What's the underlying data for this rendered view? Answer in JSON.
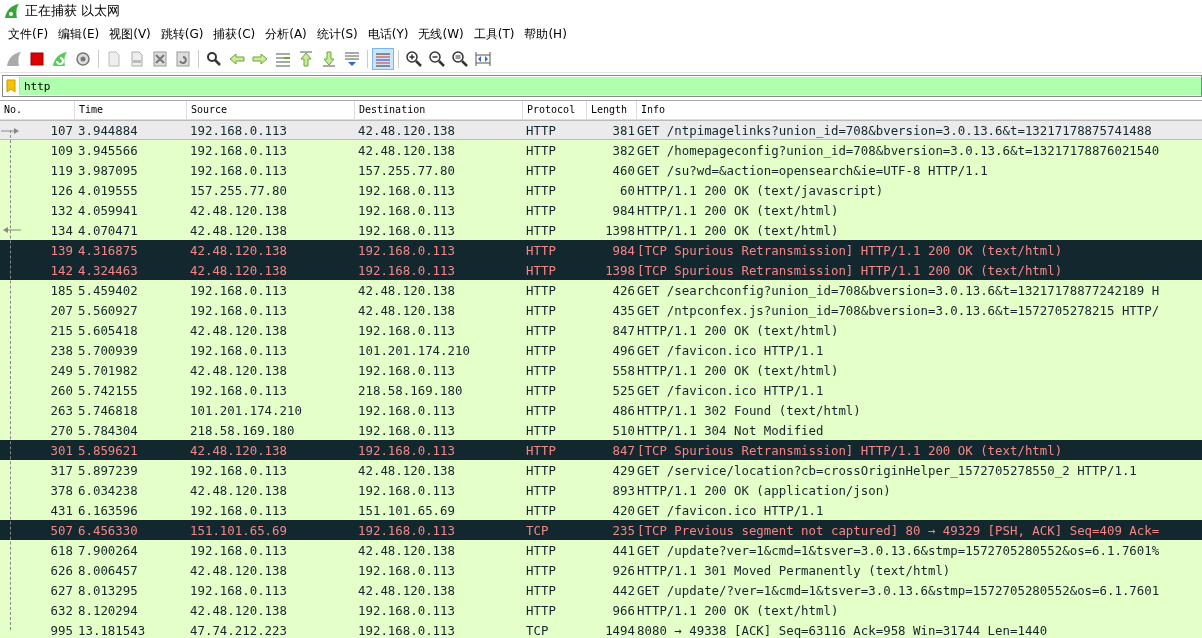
{
  "window": {
    "title": "正在捕获 以太网"
  },
  "menu": [
    "文件(F)",
    "编辑(E)",
    "视图(V)",
    "跳转(G)",
    "捕获(C)",
    "分析(A)",
    "统计(S)",
    "电话(Y)",
    "无线(W)",
    "工具(T)",
    "帮助(H)"
  ],
  "toolbar": {
    "colorize_on": true
  },
  "filter": {
    "value": "http"
  },
  "table": {
    "columns": [
      "No.",
      "Time",
      "Source",
      "Destination",
      "Protocol",
      "Length",
      "Info"
    ],
    "rows": [
      {
        "no": "107",
        "time": "3.944884",
        "source": "192.168.0.113",
        "destination": "42.48.120.138",
        "protocol": "HTTP",
        "length": "381",
        "info": "GET /ntpimagelinks?union_id=708&bversion=3.0.13.6&t=13217178875741488",
        "kind": "normal",
        "selected": true,
        "request_arrow": true
      },
      {
        "no": "109",
        "time": "3.945566",
        "source": "192.168.0.113",
        "destination": "42.48.120.138",
        "protocol": "HTTP",
        "length": "382",
        "info": "GET /homepageconfig?union_id=708&bversion=3.0.13.6&t=13217178876021540",
        "kind": "normal",
        "selected": false
      },
      {
        "no": "119",
        "time": "3.987095",
        "source": "192.168.0.113",
        "destination": "157.255.77.80",
        "protocol": "HTTP",
        "length": "460",
        "info": "GET /su?wd=&action=opensearch&ie=UTF-8 HTTP/1.1",
        "kind": "normal",
        "selected": false
      },
      {
        "no": "126",
        "time": "4.019555",
        "source": "157.255.77.80",
        "destination": "192.168.0.113",
        "protocol": "HTTP",
        "length": "60",
        "info": "HTTP/1.1 200 OK  (text/javascript)",
        "kind": "normal",
        "selected": false
      },
      {
        "no": "132",
        "time": "4.059941",
        "source": "42.48.120.138",
        "destination": "192.168.0.113",
        "protocol": "HTTP",
        "length": "984",
        "info": "HTTP/1.1 200 OK  (text/html)",
        "kind": "normal",
        "selected": false
      },
      {
        "no": "134",
        "time": "4.070471",
        "source": "42.48.120.138",
        "destination": "192.168.0.113",
        "protocol": "HTTP",
        "length": "1398",
        "info": "HTTP/1.1 200 OK  (text/html)",
        "kind": "normal",
        "selected": false,
        "response_arrow": true
      },
      {
        "no": "139",
        "time": "4.316875",
        "source": "42.48.120.138",
        "destination": "192.168.0.113",
        "protocol": "HTTP",
        "length": "984",
        "info": "[TCP Spurious Retransmission] HTTP/1.1 200 OK  (text/html)",
        "kind": "error",
        "selected": false
      },
      {
        "no": "142",
        "time": "4.324463",
        "source": "42.48.120.138",
        "destination": "192.168.0.113",
        "protocol": "HTTP",
        "length": "1398",
        "info": "[TCP Spurious Retransmission] HTTP/1.1 200 OK  (text/html)",
        "kind": "error",
        "selected": false
      },
      {
        "no": "185",
        "time": "5.459402",
        "source": "192.168.0.113",
        "destination": "42.48.120.138",
        "protocol": "HTTP",
        "length": "426",
        "info": "GET /searchconfig?union_id=708&bversion=3.0.13.6&t=13217178877242189 H",
        "kind": "normal",
        "selected": false
      },
      {
        "no": "207",
        "time": "5.560927",
        "source": "192.168.0.113",
        "destination": "42.48.120.138",
        "protocol": "HTTP",
        "length": "435",
        "info": "GET /ntpconfex.js?union_id=708&bversion=3.0.13.6&t=1572705278215 HTTP/",
        "kind": "normal",
        "selected": false
      },
      {
        "no": "215",
        "time": "5.605418",
        "source": "42.48.120.138",
        "destination": "192.168.0.113",
        "protocol": "HTTP",
        "length": "847",
        "info": "HTTP/1.1 200 OK  (text/html)",
        "kind": "normal",
        "selected": false
      },
      {
        "no": "238",
        "time": "5.700939",
        "source": "192.168.0.113",
        "destination": "101.201.174.210",
        "protocol": "HTTP",
        "length": "496",
        "info": "GET /favicon.ico HTTP/1.1",
        "kind": "normal",
        "selected": false
      },
      {
        "no": "249",
        "time": "5.701982",
        "source": "42.48.120.138",
        "destination": "192.168.0.113",
        "protocol": "HTTP",
        "length": "558",
        "info": "HTTP/1.1 200 OK  (text/html)",
        "kind": "normal",
        "selected": false
      },
      {
        "no": "260",
        "time": "5.742155",
        "source": "192.168.0.113",
        "destination": "218.58.169.180",
        "protocol": "HTTP",
        "length": "525",
        "info": "GET /favicon.ico HTTP/1.1",
        "kind": "normal",
        "selected": false
      },
      {
        "no": "263",
        "time": "5.746818",
        "source": "101.201.174.210",
        "destination": "192.168.0.113",
        "protocol": "HTTP",
        "length": "486",
        "info": "HTTP/1.1 302 Found  (text/html)",
        "kind": "normal",
        "selected": false
      },
      {
        "no": "270",
        "time": "5.784304",
        "source": "218.58.169.180",
        "destination": "192.168.0.113",
        "protocol": "HTTP",
        "length": "510",
        "info": "HTTP/1.1 304 Not Modified",
        "kind": "normal",
        "selected": false
      },
      {
        "no": "301",
        "time": "5.859621",
        "source": "42.48.120.138",
        "destination": "192.168.0.113",
        "protocol": "HTTP",
        "length": "847",
        "info": "[TCP Spurious Retransmission] HTTP/1.1 200 OK  (text/html)",
        "kind": "error",
        "selected": false
      },
      {
        "no": "317",
        "time": "5.897239",
        "source": "192.168.0.113",
        "destination": "42.48.120.138",
        "protocol": "HTTP",
        "length": "429",
        "info": "GET /service/location?cb=crossOriginHelper_1572705278550_2 HTTP/1.1",
        "kind": "normal",
        "selected": false
      },
      {
        "no": "378",
        "time": "6.034238",
        "source": "42.48.120.138",
        "destination": "192.168.0.113",
        "protocol": "HTTP",
        "length": "893",
        "info": "HTTP/1.1 200 OK  (application/json)",
        "kind": "normal",
        "selected": false
      },
      {
        "no": "431",
        "time": "6.163596",
        "source": "192.168.0.113",
        "destination": "151.101.65.69",
        "protocol": "HTTP",
        "length": "420",
        "info": "GET /favicon.ico HTTP/1.1",
        "kind": "normal",
        "selected": false
      },
      {
        "no": "507",
        "time": "6.456330",
        "source": "151.101.65.69",
        "destination": "192.168.0.113",
        "protocol": "TCP",
        "length": "235",
        "info": "[TCP Previous segment not captured] 80 → 49329 [PSH, ACK] Seq=409 Ack=",
        "kind": "error",
        "selected": false
      },
      {
        "no": "618",
        "time": "7.900264",
        "source": "192.168.0.113",
        "destination": "42.48.120.138",
        "protocol": "HTTP",
        "length": "441",
        "info": "GET /update?ver=1&cmd=1&tsver=3.0.13.6&stmp=1572705280552&os=6.1.7601%",
        "kind": "normal",
        "selected": false
      },
      {
        "no": "626",
        "time": "8.006457",
        "source": "42.48.120.138",
        "destination": "192.168.0.113",
        "protocol": "HTTP",
        "length": "926",
        "info": "HTTP/1.1 301 Moved Permanently  (text/html)",
        "kind": "normal",
        "selected": false
      },
      {
        "no": "627",
        "time": "8.013295",
        "source": "192.168.0.113",
        "destination": "42.48.120.138",
        "protocol": "HTTP",
        "length": "442",
        "info": "GET /update/?ver=1&cmd=1&tsver=3.0.13.6&stmp=1572705280552&os=6.1.7601",
        "kind": "normal",
        "selected": false
      },
      {
        "no": "632",
        "time": "8.120294",
        "source": "42.48.120.138",
        "destination": "192.168.0.113",
        "protocol": "HTTP",
        "length": "966",
        "info": "HTTP/1.1 200 OK  (text/html)",
        "kind": "normal",
        "selected": false
      },
      {
        "no": "995",
        "time": "13.181543",
        "source": "47.74.212.223",
        "destination": "192.168.0.113",
        "protocol": "TCP",
        "length": "1494",
        "info": "8080 → 49338 [ACK] Seq=63116 Ack=958 Win=31744 Len=1440",
        "kind": "normal",
        "selected": false
      }
    ]
  }
}
